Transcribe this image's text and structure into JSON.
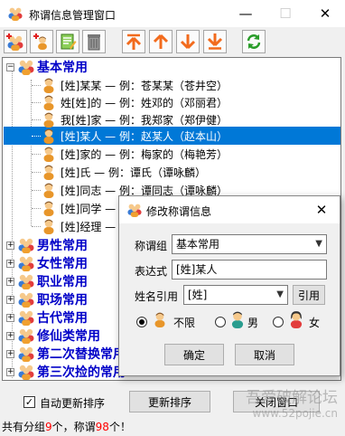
{
  "window": {
    "title": "称谓信息管理窗口",
    "min_glyph": "—",
    "max_glyph": "☐",
    "close_glyph": "✕"
  },
  "toolbar": {
    "buttons": [
      "add-group-icon",
      "add-item-icon",
      "edit-icon",
      "delete-icon",
      "move-top-icon",
      "move-up-icon",
      "move-down-icon",
      "move-bottom-icon",
      "refresh-icon"
    ],
    "arrow_color": "#f26b1d",
    "refresh_color": "#2a9d2a"
  },
  "tree": {
    "expanded_group": "基本常用",
    "items": [
      "[姓]某某 — 例：苍某某（苍井空）",
      "姓[姓]的 — 例：姓邓的（邓丽君）",
      "我[姓]家 — 例：我郑家（郑伊健）",
      "[姓]某人 — 例：赵某人（赵本山）",
      "[姓]家的 — 例：梅家的（梅艳芳）",
      "[姓]氏 — 例：谭氏（谭咏麟）",
      "[姓]同志 — 例：谭同志（谭咏麟）",
      "[姓]同学 — 例：",
      "[姓]经理 — 例："
    ],
    "selected_index": 3,
    "groups": [
      "男性常用",
      "女性常用",
      "职业常用",
      "职场常用",
      "古代常用",
      "修仙类常用",
      "第二次替换常用",
      "第三次捡的常用"
    ]
  },
  "bottom": {
    "auto_update_label": "自动更新排序",
    "auto_update_checked": "✓",
    "update_sort_button": "更新排序",
    "close_window_button": "关闭窗口"
  },
  "status": {
    "prefix": "共有分组",
    "groups_count": "9",
    "middle": "个，称谓",
    "items_count": "98",
    "suffix": "个！"
  },
  "watermark": {
    "line1": "吾爱破解论坛",
    "line2": "www.52pojie.cn"
  },
  "dialog": {
    "title": "修改称谓信息",
    "close_glyph": "✕",
    "group_label": "称谓组",
    "group_value": "基本常用",
    "expr_label": "表达式",
    "expr_value": "[姓]某人",
    "ref_label": "姓名引用",
    "ref_value": "[姓]",
    "ref_button": "引用",
    "gender_options": [
      "不限",
      "男",
      "女"
    ],
    "gender_selected": "不限",
    "ok_button": "确定",
    "cancel_button": "取消"
  }
}
